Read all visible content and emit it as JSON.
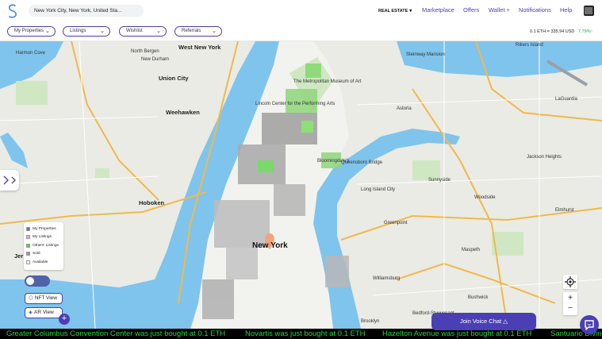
{
  "header": {
    "search_value": "New York City, New York, United Sta...",
    "nav": [
      {
        "label": "REAL ESTATE"
      },
      {
        "label": "Marketplace"
      },
      {
        "label": "Offers"
      },
      {
        "label": "Wallet"
      },
      {
        "label": "Notifications"
      },
      {
        "label": "Help"
      }
    ],
    "wallet_plus": "+",
    "dropdown_chevron": "▾"
  },
  "filters": {
    "items": [
      {
        "label": "My Properties"
      },
      {
        "label": "Listings"
      },
      {
        "label": "Wishlist"
      },
      {
        "label": "Referrals"
      }
    ],
    "chevron": "⌄",
    "eth_rate": "0.1 ETH = 335.94 USD",
    "eth_change": "7.79%",
    "eth_arrow": "↑"
  },
  "map": {
    "labels": [
      {
        "text": "West New York",
        "cls": "big"
      },
      {
        "text": "Union City",
        "cls": "big"
      },
      {
        "text": "Weehawken",
        "cls": "big"
      },
      {
        "text": "Hoboken",
        "cls": "big"
      },
      {
        "text": "Jer",
        "cls": "big"
      },
      {
        "text": "New York",
        "cls": "city"
      },
      {
        "text": "Harmon Cove",
        "cls": ""
      },
      {
        "text": "North Bergen",
        "cls": ""
      },
      {
        "text": "New Durham",
        "cls": ""
      },
      {
        "text": "Lincoln Center for the Performing Arts",
        "cls": ""
      },
      {
        "text": "Bloomingdale's",
        "cls": ""
      },
      {
        "text": "The Metropolitan Museum of Art",
        "cls": ""
      },
      {
        "text": "Rikers Island",
        "cls": ""
      },
      {
        "text": "Steinway Mansion",
        "cls": ""
      },
      {
        "text": "Astoria",
        "cls": ""
      },
      {
        "text": "Long Island City",
        "cls": ""
      },
      {
        "text": "Queensboro Bridge",
        "cls": ""
      },
      {
        "text": "Sunnyside",
        "cls": ""
      },
      {
        "text": "Woodside",
        "cls": ""
      },
      {
        "text": "Jackson Heights",
        "cls": ""
      },
      {
        "text": "Maspeth",
        "cls": ""
      },
      {
        "text": "Elmhurst",
        "cls": ""
      },
      {
        "text": "Greenpoint",
        "cls": ""
      },
      {
        "text": "Williamsburg",
        "cls": ""
      },
      {
        "text": "Bushwick",
        "cls": ""
      },
      {
        "text": "Bedford-Stuyvesant",
        "cls": ""
      },
      {
        "text": "Brooklyn",
        "cls": ""
      },
      {
        "text": "LaGuardia",
        "cls": ""
      }
    ],
    "legend": [
      {
        "label": "My Properties",
        "color": "#4a78d0"
      },
      {
        "label": "My Listings",
        "color": "#e7a6f0"
      },
      {
        "label": "Others' Listings",
        "color": "#4fd93f"
      },
      {
        "label": "Sold",
        "color": "#9a9a9a"
      },
      {
        "label": "Available",
        "color": "#ffffff"
      }
    ],
    "nft_view": "NFT View",
    "ar_view": "AR View",
    "add_symbol": "+",
    "zoom_in": "+",
    "zoom_out": "−"
  },
  "voice_chat": {
    "label": "Join Voice Chat",
    "icon": "△"
  },
  "ticker": [
    "Greater Columbus Convention Center was just bought at 0.1 ETH",
    "Novartis was just bought at 0.1 ETH",
    "Hazelton Avenue was just bought at 0.1 ETH",
    "Santuario Divin"
  ],
  "colors": {
    "accent": "#4b3fb5",
    "water": "#7fc4ec",
    "ticker_text": "#22d73c",
    "positive": "#1aa84a"
  }
}
